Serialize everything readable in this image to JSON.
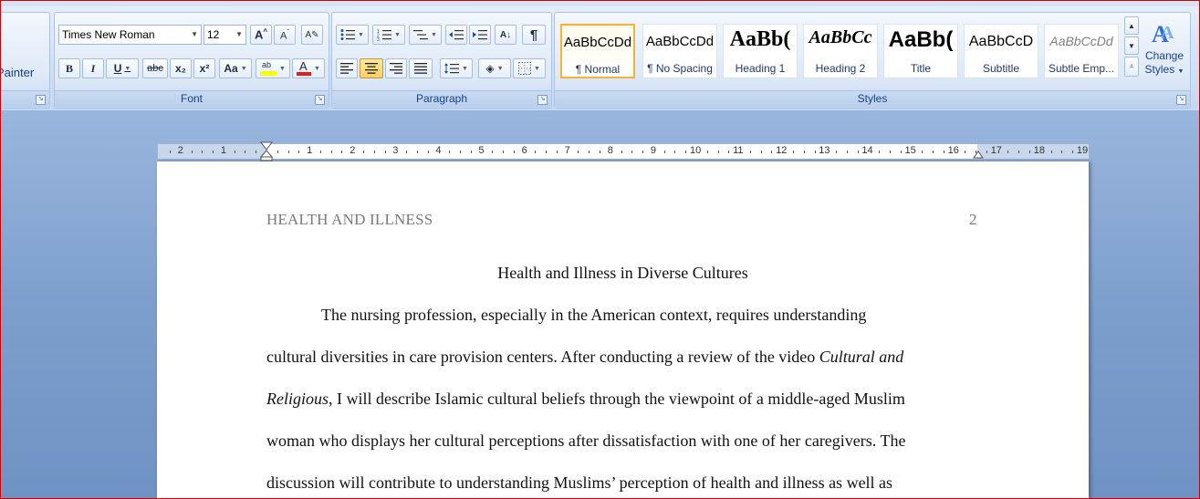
{
  "ribbon": {
    "clipboard": {
      "format_painter_label": "Painter"
    },
    "font": {
      "group_label": "Font",
      "font_name": "Times New Roman",
      "font_size": "12",
      "bold": "B",
      "italic": "I",
      "underline": "U",
      "strike": "abc",
      "subscript": "x₂",
      "superscript": "x²",
      "change_case": "Aa",
      "highlight_color": "#ffff00",
      "font_color": "#e81b1b"
    },
    "paragraph": {
      "group_label": "Paragraph",
      "pilcrow": "¶"
    },
    "styles": {
      "group_label": "Styles",
      "items": [
        {
          "sample": "AaBbCcDd",
          "label": "¶ Normal",
          "selected": true
        },
        {
          "sample": "AaBbCcDd",
          "label": "¶ No Spacing"
        },
        {
          "sample": "AaBb(",
          "label": "Heading 1"
        },
        {
          "sample": "AaBbCc",
          "label": "Heading 2"
        },
        {
          "sample": "AaBb(",
          "label": "Title"
        },
        {
          "sample": "AaBbCcD",
          "label": "Subtitle"
        },
        {
          "sample": "AaBbCcDd",
          "label": "Subtle Emp..."
        }
      ],
      "change_styles_line1": "Change",
      "change_styles_line2": "Styles"
    }
  },
  "ruler": {
    "left_numbers": [
      "2",
      "1"
    ],
    "right_numbers": [
      "1",
      "2",
      "3",
      "4",
      "5",
      "6",
      "7",
      "8",
      "9",
      "10",
      "11",
      "12",
      "13",
      "14",
      "15",
      "16",
      "17",
      "18",
      "19"
    ]
  },
  "document": {
    "header_text": "HEALTH AND ILLNESS",
    "page_number": "2",
    "title": "Health and Illness in Diverse Cultures",
    "lines": [
      {
        "parts": [
          {
            "t": "The nursing profession, especially in the American context, requires understanding"
          }
        ]
      },
      {
        "parts": [
          {
            "t": "cultural diversities in care provision centers. After conducting a review of the video "
          },
          {
            "t": "Cultural and",
            "i": true
          }
        ]
      },
      {
        "parts": [
          {
            "t": "Religious",
            "i": true
          },
          {
            "t": ", I will describe Islamic cultural beliefs through the viewpoint of a middle-aged Muslim"
          }
        ]
      },
      {
        "parts": [
          {
            "t": "woman who displays her cultural perceptions after dissatisfaction with one of her caregivers. The"
          }
        ]
      },
      {
        "parts": [
          {
            "t": "discussion will contribute to understanding Muslims’ perception of health and illness as well as"
          }
        ]
      }
    ]
  }
}
